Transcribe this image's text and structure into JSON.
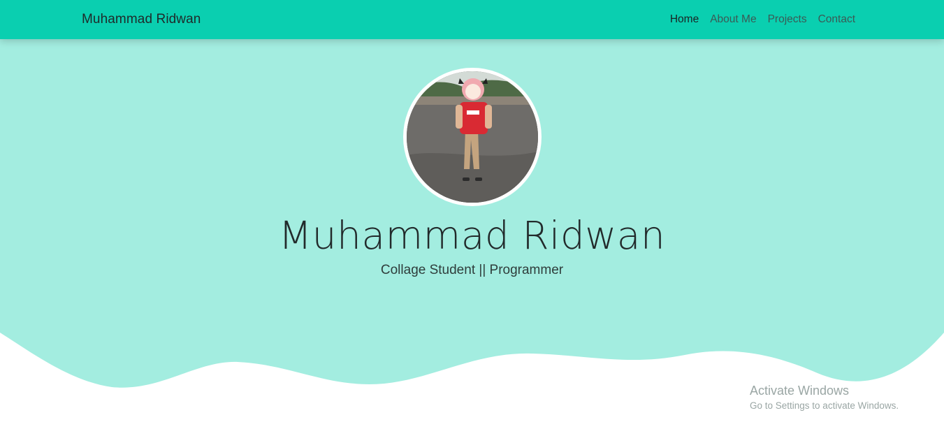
{
  "navbar": {
    "brand": "Muhammad Ridwan",
    "links": [
      {
        "label": "Home",
        "active": true
      },
      {
        "label": "About Me",
        "active": false
      },
      {
        "label": "Projects",
        "active": false
      },
      {
        "label": "Contact",
        "active": false
      }
    ],
    "background_color": "#0acfb0"
  },
  "hero": {
    "name": "Muhammad Ridwan",
    "subtitle": "Collage Student || Programmer",
    "background_color": "#a3ede0",
    "avatar": {
      "icon": "profile-photo"
    }
  },
  "watermark": {
    "title": "Activate Windows",
    "subtitle": "Go to Settings to activate Windows."
  }
}
